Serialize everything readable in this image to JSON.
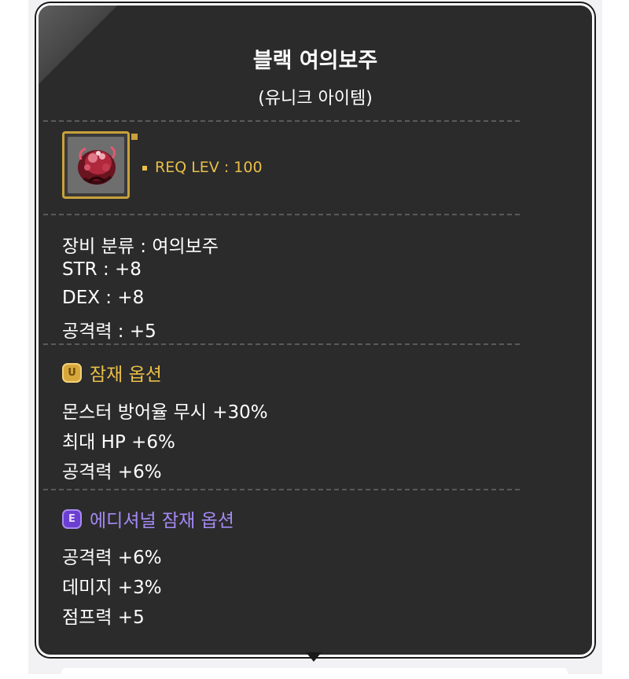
{
  "tooltip": {
    "title": "블랙 여의보주",
    "subtitle": "(유니크 아이템)",
    "req_level": "REQ LEV : 100",
    "base_stats": [
      "장비 분류 : 여의보주",
      "STR : +8",
      "DEX : +8",
      "공격력 : +5"
    ],
    "potential": {
      "badge": "U",
      "header": "잠재 옵션",
      "color": "#e9bf49",
      "lines": [
        "몬스터 방어율 무시 +30%",
        "최대 HP +6%",
        "공격력 +6%"
      ]
    },
    "additional_potential": {
      "badge": "E",
      "header": "에디셔널 잠재 옵션",
      "color": "#a48af5",
      "lines": [
        "공격력 +6%",
        "데미지 +3%",
        "점프력 +5"
      ]
    }
  },
  "colors": {
    "panel_bg": "#2b2b2b",
    "frame_gold": "#c9a13b",
    "req_gold": "#e9bf49",
    "text": "#ffffff"
  },
  "icons": {
    "item": "black-orb-icon",
    "potential": "unique-potential-icon",
    "additional": "epic-additional-potential-icon"
  }
}
